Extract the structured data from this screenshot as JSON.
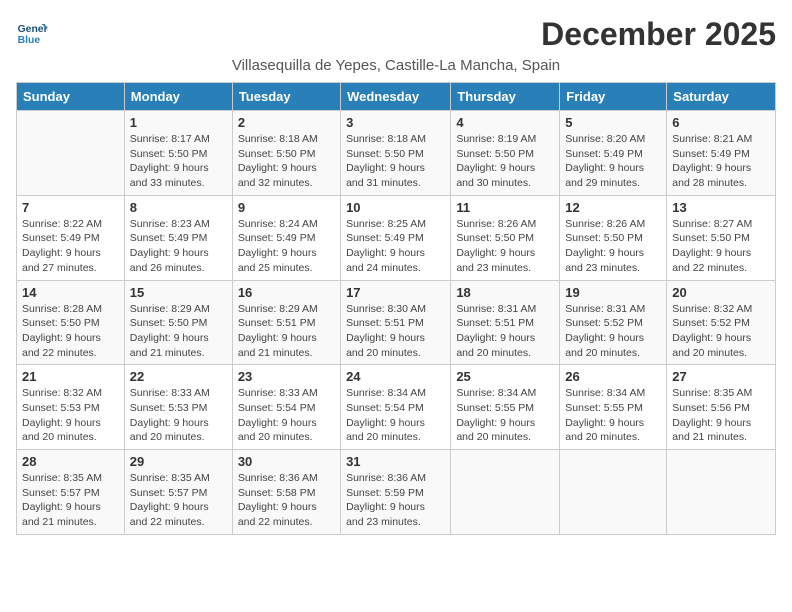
{
  "logo": {
    "general": "General",
    "blue": "Blue"
  },
  "title": "December 2025",
  "subtitle": "Villasequilla de Yepes, Castille-La Mancha, Spain",
  "days_of_week": [
    "Sunday",
    "Monday",
    "Tuesday",
    "Wednesday",
    "Thursday",
    "Friday",
    "Saturday"
  ],
  "weeks": [
    [
      {
        "day": "",
        "info": ""
      },
      {
        "day": "1",
        "info": "Sunrise: 8:17 AM\nSunset: 5:50 PM\nDaylight: 9 hours\nand 33 minutes."
      },
      {
        "day": "2",
        "info": "Sunrise: 8:18 AM\nSunset: 5:50 PM\nDaylight: 9 hours\nand 32 minutes."
      },
      {
        "day": "3",
        "info": "Sunrise: 8:18 AM\nSunset: 5:50 PM\nDaylight: 9 hours\nand 31 minutes."
      },
      {
        "day": "4",
        "info": "Sunrise: 8:19 AM\nSunset: 5:50 PM\nDaylight: 9 hours\nand 30 minutes."
      },
      {
        "day": "5",
        "info": "Sunrise: 8:20 AM\nSunset: 5:49 PM\nDaylight: 9 hours\nand 29 minutes."
      },
      {
        "day": "6",
        "info": "Sunrise: 8:21 AM\nSunset: 5:49 PM\nDaylight: 9 hours\nand 28 minutes."
      }
    ],
    [
      {
        "day": "7",
        "info": "Sunrise: 8:22 AM\nSunset: 5:49 PM\nDaylight: 9 hours\nand 27 minutes."
      },
      {
        "day": "8",
        "info": "Sunrise: 8:23 AM\nSunset: 5:49 PM\nDaylight: 9 hours\nand 26 minutes."
      },
      {
        "day": "9",
        "info": "Sunrise: 8:24 AM\nSunset: 5:49 PM\nDaylight: 9 hours\nand 25 minutes."
      },
      {
        "day": "10",
        "info": "Sunrise: 8:25 AM\nSunset: 5:49 PM\nDaylight: 9 hours\nand 24 minutes."
      },
      {
        "day": "11",
        "info": "Sunrise: 8:26 AM\nSunset: 5:50 PM\nDaylight: 9 hours\nand 23 minutes."
      },
      {
        "day": "12",
        "info": "Sunrise: 8:26 AM\nSunset: 5:50 PM\nDaylight: 9 hours\nand 23 minutes."
      },
      {
        "day": "13",
        "info": "Sunrise: 8:27 AM\nSunset: 5:50 PM\nDaylight: 9 hours\nand 22 minutes."
      }
    ],
    [
      {
        "day": "14",
        "info": "Sunrise: 8:28 AM\nSunset: 5:50 PM\nDaylight: 9 hours\nand 22 minutes."
      },
      {
        "day": "15",
        "info": "Sunrise: 8:29 AM\nSunset: 5:50 PM\nDaylight: 9 hours\nand 21 minutes."
      },
      {
        "day": "16",
        "info": "Sunrise: 8:29 AM\nSunset: 5:51 PM\nDaylight: 9 hours\nand 21 minutes."
      },
      {
        "day": "17",
        "info": "Sunrise: 8:30 AM\nSunset: 5:51 PM\nDaylight: 9 hours\nand 20 minutes."
      },
      {
        "day": "18",
        "info": "Sunrise: 8:31 AM\nSunset: 5:51 PM\nDaylight: 9 hours\nand 20 minutes."
      },
      {
        "day": "19",
        "info": "Sunrise: 8:31 AM\nSunset: 5:52 PM\nDaylight: 9 hours\nand 20 minutes."
      },
      {
        "day": "20",
        "info": "Sunrise: 8:32 AM\nSunset: 5:52 PM\nDaylight: 9 hours\nand 20 minutes."
      }
    ],
    [
      {
        "day": "21",
        "info": "Sunrise: 8:32 AM\nSunset: 5:53 PM\nDaylight: 9 hours\nand 20 minutes."
      },
      {
        "day": "22",
        "info": "Sunrise: 8:33 AM\nSunset: 5:53 PM\nDaylight: 9 hours\nand 20 minutes."
      },
      {
        "day": "23",
        "info": "Sunrise: 8:33 AM\nSunset: 5:54 PM\nDaylight: 9 hours\nand 20 minutes."
      },
      {
        "day": "24",
        "info": "Sunrise: 8:34 AM\nSunset: 5:54 PM\nDaylight: 9 hours\nand 20 minutes."
      },
      {
        "day": "25",
        "info": "Sunrise: 8:34 AM\nSunset: 5:55 PM\nDaylight: 9 hours\nand 20 minutes."
      },
      {
        "day": "26",
        "info": "Sunrise: 8:34 AM\nSunset: 5:55 PM\nDaylight: 9 hours\nand 20 minutes."
      },
      {
        "day": "27",
        "info": "Sunrise: 8:35 AM\nSunset: 5:56 PM\nDaylight: 9 hours\nand 21 minutes."
      }
    ],
    [
      {
        "day": "28",
        "info": "Sunrise: 8:35 AM\nSunset: 5:57 PM\nDaylight: 9 hours\nand 21 minutes."
      },
      {
        "day": "29",
        "info": "Sunrise: 8:35 AM\nSunset: 5:57 PM\nDaylight: 9 hours\nand 22 minutes."
      },
      {
        "day": "30",
        "info": "Sunrise: 8:36 AM\nSunset: 5:58 PM\nDaylight: 9 hours\nand 22 minutes."
      },
      {
        "day": "31",
        "info": "Sunrise: 8:36 AM\nSunset: 5:59 PM\nDaylight: 9 hours\nand 23 minutes."
      },
      {
        "day": "",
        "info": ""
      },
      {
        "day": "",
        "info": ""
      },
      {
        "day": "",
        "info": ""
      }
    ]
  ]
}
